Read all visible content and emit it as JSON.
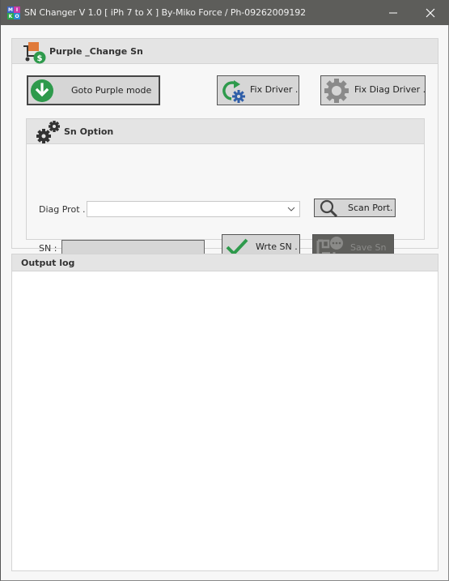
{
  "window": {
    "title": "SN Changer V 1.0  [ iPh 7 to X ] By-Miko Force  / Ph-09262009192",
    "logo_letters": [
      "M",
      "I",
      "K",
      "O"
    ],
    "logo_colors": [
      "#3a64c8",
      "#c83aa8",
      "#2aa84a",
      "#2a8ad0"
    ],
    "minimize_label": "—",
    "close_label": "✕"
  },
  "main_panel": {
    "title": "Purple  _Change Sn",
    "icon": "cart-dollar-icon",
    "buttons": {
      "goto_purple": {
        "label": "Goto Purple mode",
        "icon": "download-arrow-icon"
      },
      "fix_driver": {
        "label": "Fix Driver .",
        "icon": "refresh-gear-icon"
      },
      "fix_diag_driver": {
        "label": "Fix Diag Driver .",
        "icon": "gear-icon"
      }
    }
  },
  "sn_option": {
    "title": "Sn Option",
    "icon": "gears-icon",
    "diag_port_label": "Diag Prot .",
    "diag_port_value": "",
    "scan_port_label": "Scan Port.",
    "sn_label": "SN :",
    "sn_value": "",
    "write_sn_label": "Wrte SN .",
    "save_sn_label": "Save Sn"
  },
  "output_log": {
    "title": "Output log",
    "content": ""
  },
  "colors": {
    "titlebar": "#5d5d5a",
    "accent_green": "#2e9a4c",
    "accent_orange": "#e07a3a",
    "gear_blue": "#2f5ea8"
  }
}
